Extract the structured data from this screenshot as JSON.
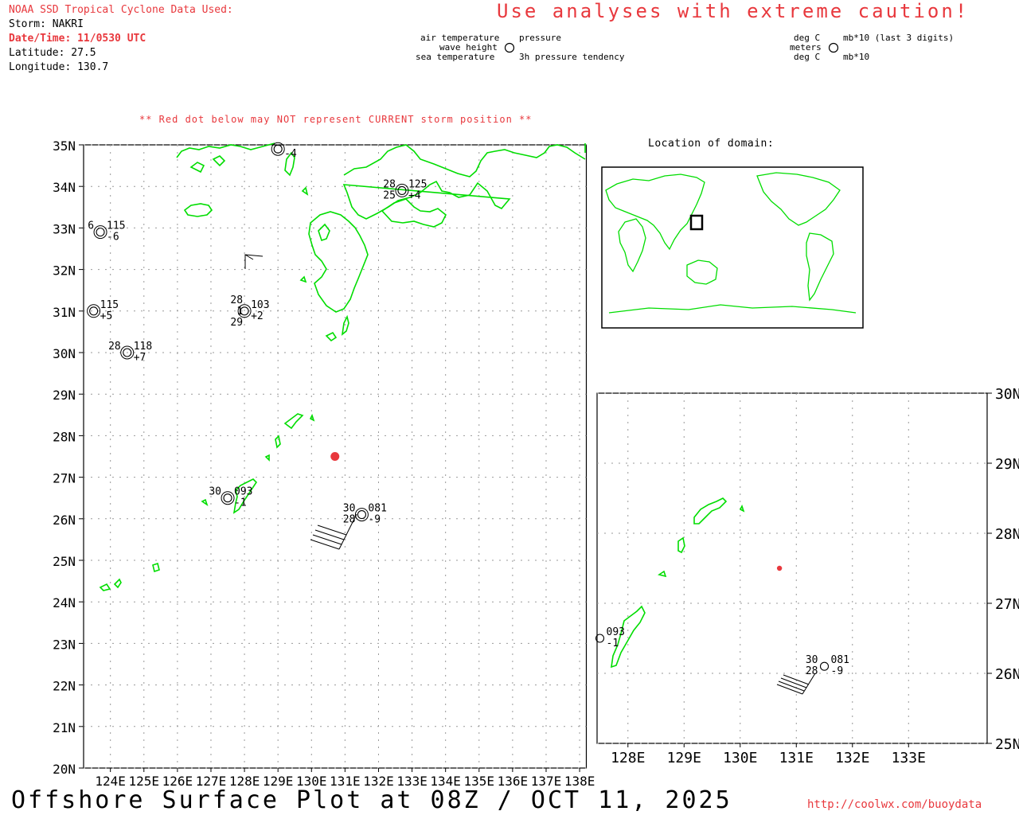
{
  "header": {
    "source": "NOAA SSD Tropical Cyclone Data Used:",
    "storm": "Storm: NAKRI",
    "datetime": "Date/Time: 11/0530 UTC",
    "latitude": "Latitude: 27.5",
    "longitude": "Longitude: 130.7",
    "caution": "Use analyses with extreme caution!"
  },
  "legend": {
    "left_top": "air temperature",
    "left_mid": "wave height",
    "left_bot": "sea temperature",
    "right_top": "pressure",
    "right_bot": "3h pressure tendency",
    "unit_left_top": "deg C",
    "unit_left_mid": "meters",
    "unit_left_bot": "deg C",
    "unit_right_top": "mb*10 (last 3 digits)",
    "unit_right_bot": "mb*10"
  },
  "note": "** Red dot below may NOT represent CURRENT storm position **",
  "domain_label": "Location of domain:",
  "footer": {
    "title": "Offshore Surface Plot at 08Z / OCT 11, 2025",
    "url": "http://coolwx.com/buoydata"
  },
  "colors": {
    "land": "#00dd00",
    "storm": "#e8383d",
    "grid": "#999999",
    "text_red": "#e8383d"
  },
  "main_map": {
    "lat_labels": [
      "35N",
      "34N",
      "33N",
      "32N",
      "31N",
      "30N",
      "29N",
      "28N",
      "27N",
      "26N",
      "25N",
      "24N",
      "23N",
      "22N",
      "21N",
      "20N"
    ],
    "lon_labels": [
      "124E",
      "125E",
      "126E",
      "127E",
      "128E",
      "129E",
      "130E",
      "131E",
      "132E",
      "133E",
      "134E",
      "135E",
      "136E",
      "137E",
      "138E"
    ],
    "storm": {
      "lat": 27.5,
      "lon": 130.7
    },
    "stations": [
      {
        "lat": 34.9,
        "lon": 129.0,
        "obs": [
          "-4"
        ]
      },
      {
        "lat": 33.9,
        "lon": 132.7,
        "obs": [
          "28",
          "125",
          "25",
          "+4"
        ]
      },
      {
        "lat": 32.9,
        "lon": 123.7,
        "obs": [
          "6",
          "115",
          "-6"
        ]
      },
      {
        "lat": 31.0,
        "lon": 128.0,
        "obs": [
          "28",
          "103",
          "1",
          "+2",
          "29"
        ]
      },
      {
        "lat": 31.0,
        "lon": 123.5,
        "obs": [
          "115",
          "+5"
        ]
      },
      {
        "lat": 30.0,
        "lon": 124.5,
        "obs": [
          "28",
          "118",
          "+7"
        ]
      },
      {
        "lat": 26.5,
        "lon": 127.5,
        "obs": [
          "30",
          "093",
          "-1"
        ]
      },
      {
        "lat": 26.1,
        "lon": 131.5,
        "obs": [
          "30",
          "081",
          "28",
          "-9"
        ]
      }
    ]
  },
  "inset_map": {
    "lat_labels": [
      "30N",
      "29N",
      "28N",
      "27N",
      "26N",
      "25N"
    ],
    "lon_labels": [
      "128E",
      "129E",
      "130E",
      "131E",
      "132E",
      "133E"
    ],
    "storm": {
      "lat": 27.5,
      "lon": 130.7
    },
    "stations": [
      {
        "lat": 26.5,
        "lon": 127.5,
        "obs": [
          "093",
          "-1"
        ]
      },
      {
        "lat": 26.1,
        "lon": 131.5,
        "obs": [
          "30",
          "081",
          "28",
          "-9"
        ]
      }
    ]
  }
}
